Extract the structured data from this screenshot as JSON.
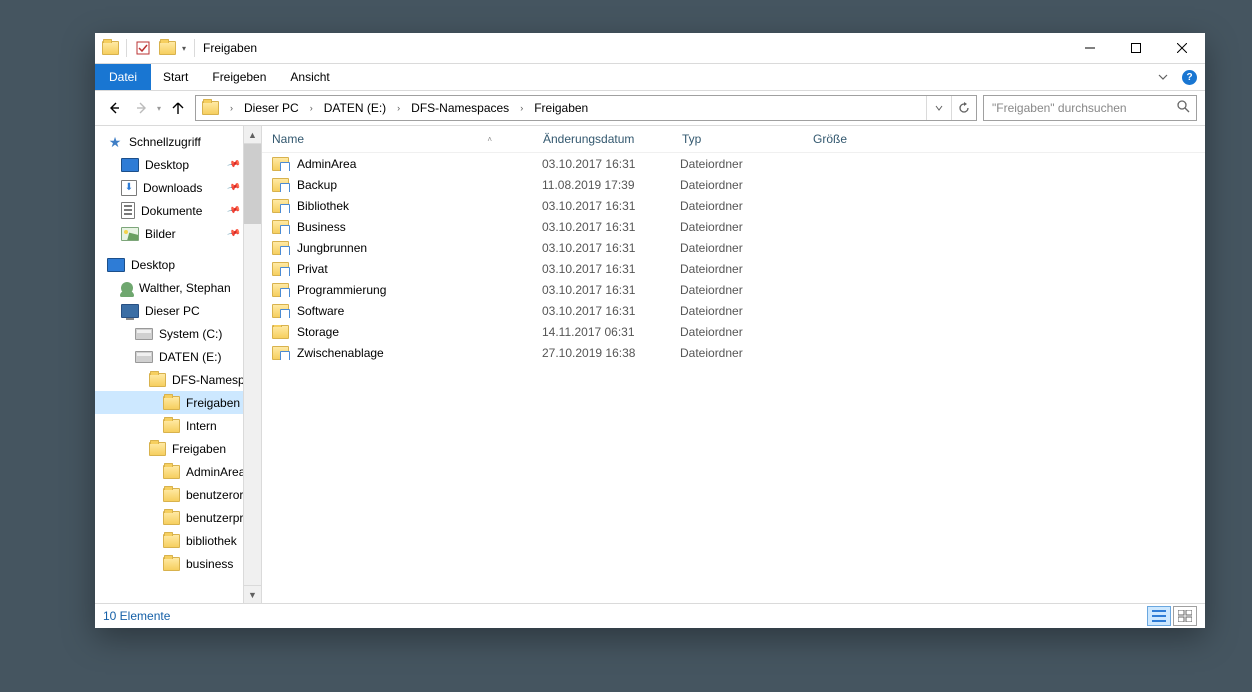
{
  "window": {
    "title": "Freigaben"
  },
  "ribbon": {
    "file": "Datei",
    "tabs": [
      "Start",
      "Freigeben",
      "Ansicht"
    ]
  },
  "breadcrumb": {
    "segments": [
      "Dieser PC",
      "DATEN (E:)",
      "DFS-Namespaces",
      "Freigaben"
    ]
  },
  "search": {
    "placeholder": "\"Freigaben\" durchsuchen"
  },
  "nav_tree": [
    {
      "icon": "star",
      "label": "Schnellzugriff",
      "indent": 0,
      "bold": true,
      "pinned": false
    },
    {
      "icon": "desktop",
      "label": "Desktop",
      "indent": 1,
      "pinned": true
    },
    {
      "icon": "download",
      "label": "Downloads",
      "indent": 1,
      "pinned": true
    },
    {
      "icon": "document",
      "label": "Dokumente",
      "indent": 1,
      "pinned": true
    },
    {
      "icon": "picture",
      "label": "Bilder",
      "indent": 1,
      "pinned": true
    },
    {
      "spacer": true
    },
    {
      "icon": "desktop",
      "label": "Desktop",
      "indent": 0,
      "bold": false
    },
    {
      "icon": "user",
      "label": "Walther, Stephan",
      "indent": 1
    },
    {
      "icon": "pc",
      "label": "Dieser PC",
      "indent": 1
    },
    {
      "icon": "drive",
      "label": "System (C:)",
      "indent": 2
    },
    {
      "icon": "drive",
      "label": "DATEN (E:)",
      "indent": 2
    },
    {
      "icon": "folder",
      "label": "DFS-Namespaces",
      "indent": 3
    },
    {
      "icon": "folder",
      "label": "Freigaben",
      "indent": 4,
      "selected": true
    },
    {
      "icon": "folder",
      "label": "Intern",
      "indent": 4
    },
    {
      "icon": "folder",
      "label": "Freigaben",
      "indent": 3
    },
    {
      "icon": "folder",
      "label": "AdminArea",
      "indent": 4
    },
    {
      "icon": "folder",
      "label": "benutzerordner",
      "indent": 4
    },
    {
      "icon": "folder",
      "label": "benutzerprofile",
      "indent": 4
    },
    {
      "icon": "folder",
      "label": "bibliothek",
      "indent": 4
    },
    {
      "icon": "folder",
      "label": "business",
      "indent": 4
    }
  ],
  "columns": {
    "name": "Name",
    "date": "Änderungsdatum",
    "type": "Typ",
    "size": "Größe"
  },
  "rows": [
    {
      "name": "AdminArea",
      "date": "03.10.2017 16:31",
      "type": "Dateiordner",
      "icon": "share-folder"
    },
    {
      "name": "Backup",
      "date": "11.08.2019 17:39",
      "type": "Dateiordner",
      "icon": "share-folder"
    },
    {
      "name": "Bibliothek",
      "date": "03.10.2017 16:31",
      "type": "Dateiordner",
      "icon": "share-folder"
    },
    {
      "name": "Business",
      "date": "03.10.2017 16:31",
      "type": "Dateiordner",
      "icon": "share-folder"
    },
    {
      "name": "Jungbrunnen",
      "date": "03.10.2017 16:31",
      "type": "Dateiordner",
      "icon": "share-folder"
    },
    {
      "name": "Privat",
      "date": "03.10.2017 16:31",
      "type": "Dateiordner",
      "icon": "share-folder"
    },
    {
      "name": "Programmierung",
      "date": "03.10.2017 16:31",
      "type": "Dateiordner",
      "icon": "share-folder"
    },
    {
      "name": "Software",
      "date": "03.10.2017 16:31",
      "type": "Dateiordner",
      "icon": "share-folder"
    },
    {
      "name": "Storage",
      "date": "14.11.2017 06:31",
      "type": "Dateiordner",
      "icon": "folder"
    },
    {
      "name": "Zwischenablage",
      "date": "27.10.2019 16:38",
      "type": "Dateiordner",
      "icon": "share-folder"
    }
  ],
  "status": {
    "item_count": "10 Elemente"
  }
}
